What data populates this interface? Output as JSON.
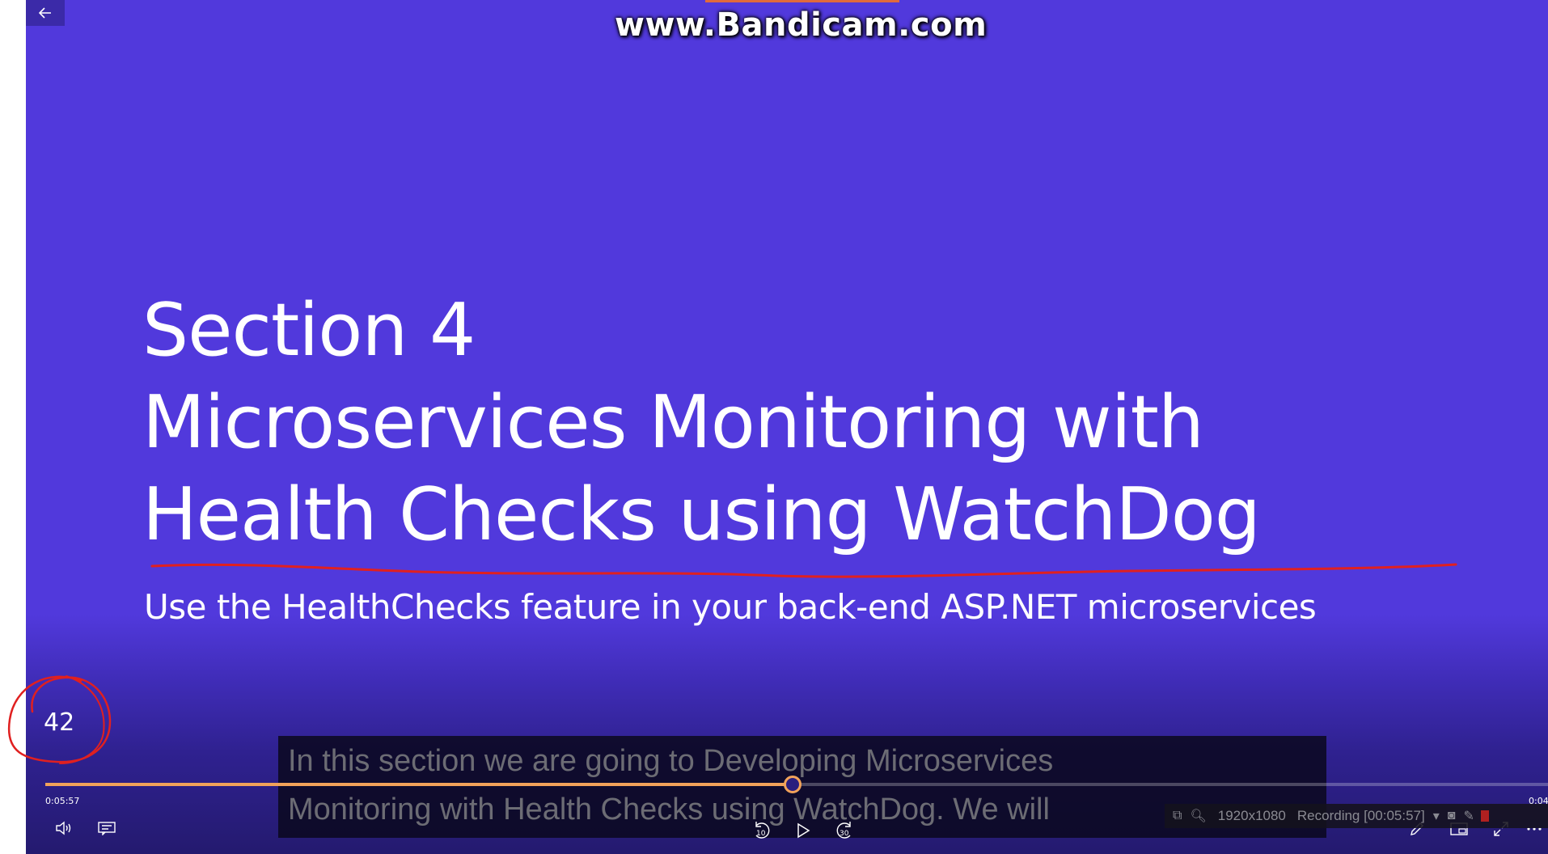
{
  "watermark": "www.Bandicam.com",
  "slide": {
    "title_lines": [
      "Section 4",
      "Microservices Monitoring with",
      "Health Checks using WatchDog"
    ],
    "subtitle": "Use the HealthChecks feature in your back-end ASP.NET microservices",
    "number": "42"
  },
  "caption": {
    "line1": "In this section we are going to Developing Microservices",
    "line2": "Monitoring with Health Checks using WatchDog. We will"
  },
  "player": {
    "time_current": "0:05:57",
    "time_total": "0:04",
    "progress": 0.497,
    "skip_back_label": "10",
    "skip_forward_label": "30"
  },
  "bandicam": {
    "resolution": "1920x1080",
    "recording": "Recording [00:05:57]"
  },
  "colors": {
    "slide_bg": "#5139dc",
    "progress": "#f1a25a",
    "ink": "#e02020"
  },
  "icons": [
    "back-arrow-icon",
    "volume-icon",
    "captions-icon",
    "rewind-10-icon",
    "play-icon",
    "forward-30-icon",
    "pen-icon",
    "mini-view-icon",
    "fullscreen-icon",
    "more-icon",
    "window-icon",
    "zoom-icon",
    "camera-icon",
    "pencil-icon"
  ]
}
